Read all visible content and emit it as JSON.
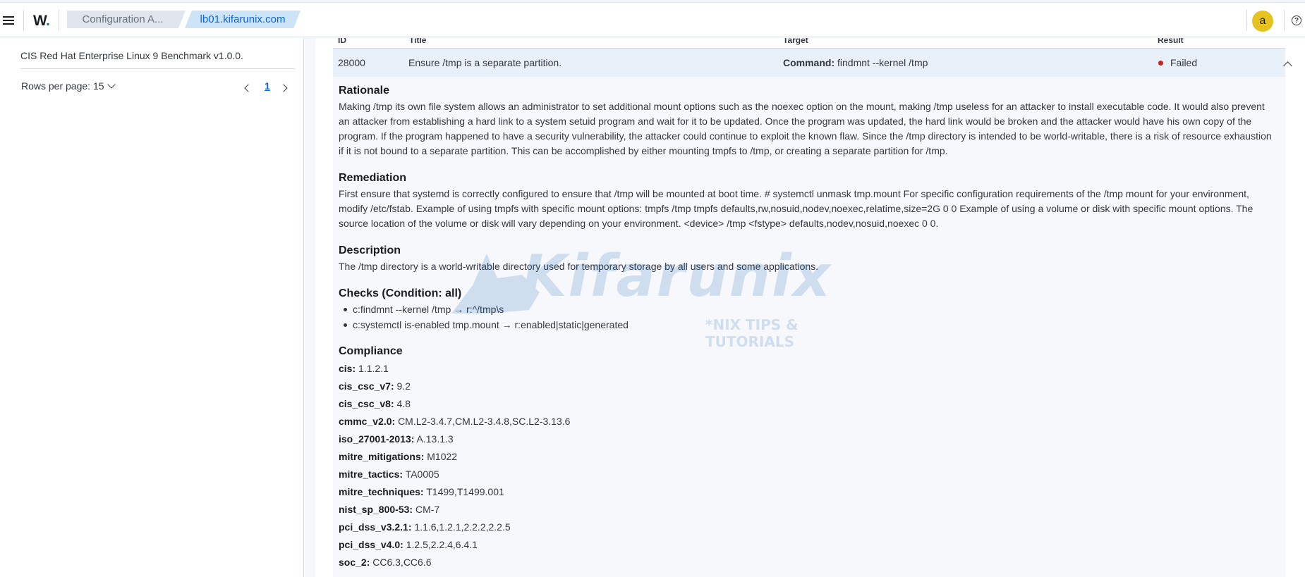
{
  "header": {
    "logo_text": "W",
    "logo_dot": ".",
    "breadcrumbs": [
      "Configuration A...",
      "lb01.kifarunix.com"
    ],
    "avatar_letter": "a",
    "help_glyph": "?"
  },
  "left_panel": {
    "benchmark": "CIS Red Hat Enterprise Linux 9 Benchmark v1.0.0.",
    "rows_per_page_label": "Rows per page: 15",
    "current_page": "1"
  },
  "table": {
    "columns": [
      "ID",
      "Title",
      "Target",
      "Result"
    ],
    "row": {
      "id": "28000",
      "title": "Ensure /tmp is a separate partition.",
      "target_label": "Command:",
      "target_value": "findmnt --kernel /tmp",
      "result": "Failed"
    }
  },
  "details": {
    "rationale_title": "Rationale",
    "rationale_text": "Making /tmp its own file system allows an administrator to set additional mount options such as the noexec option on the mount, making /tmp useless for an attacker to install executable code. It would also prevent an attacker from establishing a hard link to a system setuid program and wait for it to be updated. Once the program was updated, the hard link would be broken and the attacker would have his own copy of the program. If the program happened to have a security vulnerability, the attacker could continue to exploit the known flaw. Since the /tmp directory is intended to be world-writable, there is a risk of resource exhaustion if it is not bound to a separate partition. This can be accomplished by either mounting tmpfs to /tmp, or creating a separate partition for /tmp.",
    "remediation_title": "Remediation",
    "remediation_text": "First ensure that systemd is correctly configured to ensure that /tmp will be mounted at boot time. # systemctl unmask tmp.mount For specific configuration requirements of the /tmp mount for your environment, modify /etc/fstab. Example of using tmpfs with specific mount options: tmpfs /tmp tmpfs defaults,rw,nosuid,nodev,noexec,relatime,size=2G 0 0 Example of using a volume or disk with specific mount options. The source location of the volume or disk will vary depending on your environment. <device> /tmp <fstype> defaults,nodev,nosuid,noexec 0 0.",
    "description_title": "Description",
    "description_text": "The /tmp directory is a world-writable directory used for temporary storage by all users and some applications.",
    "checks_title": "Checks (Condition: all)",
    "checks": [
      "c:findmnt --kernel /tmp → r:^/tmp\\s",
      "c:systemctl is-enabled tmp.mount → r:enabled|static|generated"
    ],
    "compliance_title": "Compliance",
    "compliance": [
      {
        "key": "cis:",
        "value": "1.1.2.1"
      },
      {
        "key": "cis_csc_v7:",
        "value": "9.2"
      },
      {
        "key": "cis_csc_v8:",
        "value": "4.8"
      },
      {
        "key": "cmmc_v2.0:",
        "value": "CM.L2-3.4.7,CM.L2-3.4.8,SC.L2-3.13.6"
      },
      {
        "key": "iso_27001-2013:",
        "value": "A.13.1.3"
      },
      {
        "key": "mitre_mitigations:",
        "value": "M1022"
      },
      {
        "key": "mitre_tactics:",
        "value": "TA0005"
      },
      {
        "key": "mitre_techniques:",
        "value": "T1499,T1499.001"
      },
      {
        "key": "nist_sp_800-53:",
        "value": "CM-7"
      },
      {
        "key": "pci_dss_v3.2.1:",
        "value": "1.1.6,1.2.1,2.2.2,2.2.5"
      },
      {
        "key": "pci_dss_v4.0:",
        "value": "1.2.5,2.2.4,6.4.1"
      },
      {
        "key": "soc_2:",
        "value": "CC6.3,CC6.6"
      }
    ]
  },
  "watermark": {
    "brand": "Kifarunix",
    "tagline": "*NIX TIPS & TUTORIALS"
  },
  "colors": {
    "accent": "#0b64dd",
    "failed": "#bd271e",
    "avatar": "#e6c220",
    "selected_row": "#e8f1fa"
  }
}
